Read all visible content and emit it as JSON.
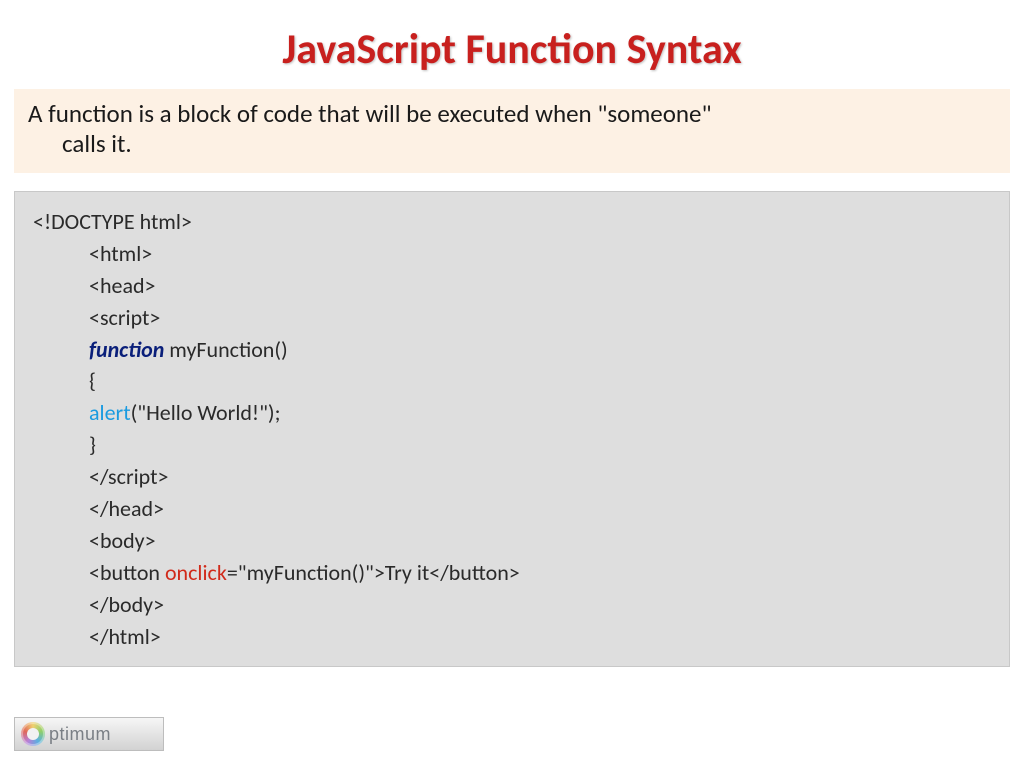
{
  "title": "JavaScript Function Syntax",
  "intro": {
    "line1": "A function is a block of code that will be executed when \"someone\"",
    "line2": "calls it."
  },
  "code": {
    "l1": "<!DOCTYPE html>",
    "l2": "<html>",
    "l3": "<head>",
    "l4": "<script>",
    "l5a": "function",
    "l5b": " myFunction()",
    "l6": "{",
    "l7a": "alert",
    "l7b": "(\"Hello World!\");",
    "l8": "}",
    "l9": "</script>",
    "l10": "</head>",
    "l11": "<body>",
    "l12a": "<button ",
    "l12b": "onclick",
    "l12c": "=\"myFunction()\">Try it</button>",
    "l13": "</body>",
    "l14": "</html>"
  },
  "logo": {
    "text": "ptimum"
  }
}
